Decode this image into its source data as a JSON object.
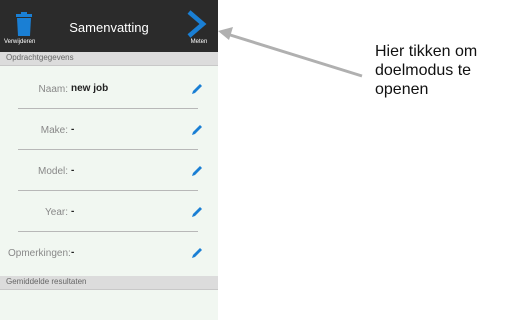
{
  "toolbar": {
    "delete_label": "Verwijderen",
    "title": "Samenvatting",
    "measure_label": "Meten"
  },
  "sections": {
    "assignment_data": "Opdrachtgegevens",
    "averaged_results": "Gemiddelde resultaten"
  },
  "fields": [
    {
      "label": "Naam:",
      "value": "new job"
    },
    {
      "label": "Make:",
      "value": "-"
    },
    {
      "label": "Model:",
      "value": "-"
    },
    {
      "label": "Year:",
      "value": "-"
    },
    {
      "label": "Opmerkingen:",
      "value": "-"
    }
  ],
  "annotation": {
    "text": "Hier tikken om doelmodus te openen"
  },
  "colors": {
    "toolbar_bg": "#2b2b2b",
    "accent_blue": "#1a7fd4",
    "screen_bg": "#f1f7f1",
    "section_bg": "#dcdcdc",
    "arrow_gray": "#b0b0b0"
  },
  "icons": {
    "delete": "trash-icon",
    "measure": "chevron-right-icon",
    "edit": "pencil-icon"
  }
}
